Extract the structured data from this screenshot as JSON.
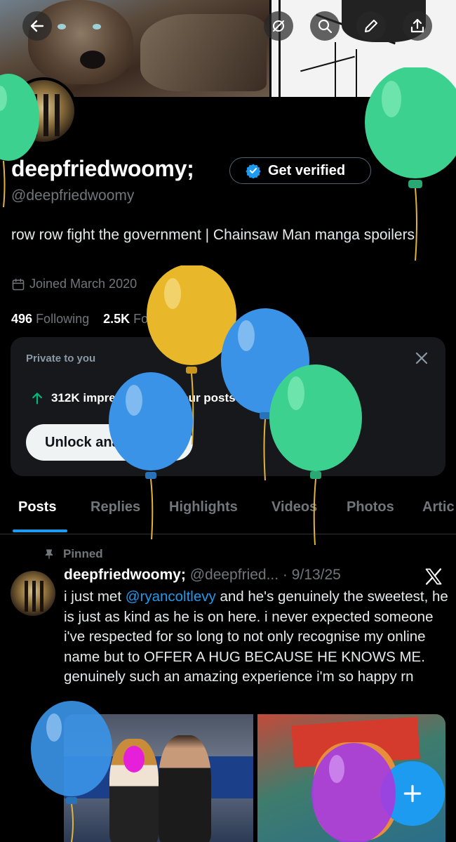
{
  "profile": {
    "display_name": "deepfriedwoomy;",
    "handle": "@deepfriedwoomy",
    "verify_label": "Get verified",
    "bio": "row row fight the government | Chainsaw Man manga spoilers",
    "joined": "Joined March 2020",
    "following_count": "496",
    "following_label": "Following",
    "followers_count": "2.5K",
    "followers_label": "Followers"
  },
  "top_bar": {
    "icons": [
      "back-arrow-icon",
      "mute-circle-icon",
      "search-icon",
      "edit-pencil-icon",
      "share-upload-icon"
    ]
  },
  "analytics_card": {
    "private_label": "Private to you",
    "impressions_text": "312K impressions on your posts in the last 7 days",
    "unlock_label": "Unlock analytics"
  },
  "tabs": [
    {
      "label": "Posts",
      "active": true
    },
    {
      "label": "Replies",
      "active": false
    },
    {
      "label": "Highlights",
      "active": false
    },
    {
      "label": "Videos",
      "active": false
    },
    {
      "label": "Photos",
      "active": false
    },
    {
      "label": "Artic",
      "active": false
    }
  ],
  "post": {
    "pinned_label": "Pinned",
    "author_name": "deepfriedwoomy;",
    "author_handle": "@deepfried...",
    "separator": " · ",
    "date": "9/13/25",
    "text_before_mention": "i just met ",
    "mention": "@ryancoltlevy",
    "text_after_mention": " and he's genuinely the sweetest, he is just as kind as he is on here. i never expected someone i've respected for so long to not only recognise my online name but to OFFER A HUG BECAUSE HE KNOWS ME. genuinely such an amazing experience i'm so happy rn"
  },
  "colors": {
    "background": "#000000",
    "accent": "#1d9bf0",
    "muted_text": "#71767b",
    "card_bg": "#16181c"
  }
}
